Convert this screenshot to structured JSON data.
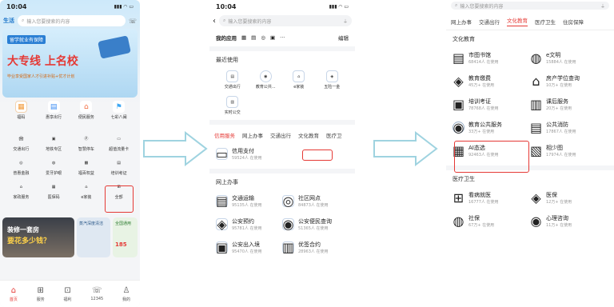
{
  "phone1": {
    "status_time": "10:04",
    "city": "生活",
    "search_placeholder": "输入您要搜索的内容",
    "banner": {
      "tag": "留学就业有保障",
      "headline": "大专线 上名校",
      "subline": "毕业享受国家人才引进补贴+优才计划"
    },
    "quick_items": [
      {
        "label": "福码",
        "color": "#f39c3d"
      },
      {
        "label": "惠享出行",
        "color": "#3d8df3"
      },
      {
        "label": "便民服务",
        "color": "#f36b3d"
      },
      {
        "label": "七彩八闽",
        "color": "#3da7f3"
      }
    ],
    "services": [
      {
        "label": "交通出行"
      },
      {
        "label": "地铁专区"
      },
      {
        "label": "智慧停车"
      },
      {
        "label": "超值流量卡"
      },
      {
        "label": "普惠金融"
      },
      {
        "label": "爱牙护眼"
      },
      {
        "label": "福百权益"
      },
      {
        "label": "培训考证"
      },
      {
        "label": "家政服务"
      },
      {
        "label": "医保码"
      },
      {
        "label": "e家装"
      },
      {
        "label": "全部"
      }
    ],
    "promo_left": {
      "line1": "装修一套房",
      "line2": "要花多少钱？"
    },
    "promo_right": {
      "line1": "全国通用",
      "line2": "185"
    },
    "promo_mid": "蒸汽深度清洁",
    "tabbar": [
      {
        "label": "首页",
        "icon": "home-icon"
      },
      {
        "label": "服务",
        "icon": "grid-icon"
      },
      {
        "label": "福利",
        "icon": "gift-icon"
      },
      {
        "label": "12345",
        "icon": "phone-icon"
      },
      {
        "label": "我的",
        "icon": "user-icon"
      }
    ]
  },
  "phone2": {
    "status_time": "10:04",
    "search_placeholder": "输入您要搜索的内容",
    "my_apps_label": "我的应用",
    "edit_label": "编辑",
    "recent_title": "最近使用",
    "recent_items": [
      {
        "label": "交通出行"
      },
      {
        "label": "教育公共..."
      },
      {
        "label": "e家装"
      },
      {
        "label": "五险一金"
      },
      {
        "label": "实时公交"
      }
    ],
    "tabs": [
      "信用服务",
      "网上办事",
      "交通出行",
      "文化教育",
      "医疗卫"
    ],
    "active_tab": "信用服务",
    "credit_item": {
      "name": "信用支付",
      "count": "59524人 在使用"
    },
    "online_title": "网上办事",
    "online_items": [
      {
        "name": "交通运输",
        "count": "95135人 在使用"
      },
      {
        "name": "社区网点",
        "count": "84873人 在使用"
      },
      {
        "name": "公安预约",
        "count": "95781人 在使用"
      },
      {
        "name": "公安便民查询",
        "count": "51365人 在使用"
      },
      {
        "name": "公安出入境",
        "count": "95470人 在使用"
      },
      {
        "name": "优签合约",
        "count": "28963人 在使用"
      }
    ]
  },
  "phone3": {
    "search_placeholder": "输入您要搜索的内容",
    "tabs": [
      "网上办事",
      "交通出行",
      "文化教育",
      "医疗卫生",
      "住房保障"
    ],
    "active_tab": "文化教育",
    "section1_title": "文化教育",
    "section1_items": [
      {
        "name": "市图书馆",
        "count": "68414人 在使用"
      },
      {
        "name": "e文明",
        "count": "15884人 在使用"
      },
      {
        "name": "教育缴费",
        "count": "45万+ 在使用"
      },
      {
        "name": "房产学位查询",
        "count": "10万+ 在使用"
      },
      {
        "name": "培训考证",
        "count": "78768人 在使用"
      },
      {
        "name": "课后服务",
        "count": "20万+ 在使用"
      },
      {
        "name": "教育公共服务",
        "count": "33万+ 在使用"
      },
      {
        "name": "公共消防",
        "count": "17867人 在使用"
      },
      {
        "name": "AI态选",
        "count": "92463人 在使用"
      },
      {
        "name": "相少图",
        "count": "17974人 在使用"
      }
    ],
    "section2_title": "医疗卫生",
    "section2_items": [
      {
        "name": "看病就医",
        "count": "16777人 在使用"
      },
      {
        "name": "医保",
        "count": "12万+ 在使用"
      },
      {
        "name": "社保",
        "count": "67万+ 在使用"
      },
      {
        "name": "心理咨询",
        "count": "11万+ 在使用"
      }
    ]
  },
  "colors": {
    "accent": "#e53935",
    "arrow": "#9fd3e0",
    "tab_active": "#e53935"
  }
}
